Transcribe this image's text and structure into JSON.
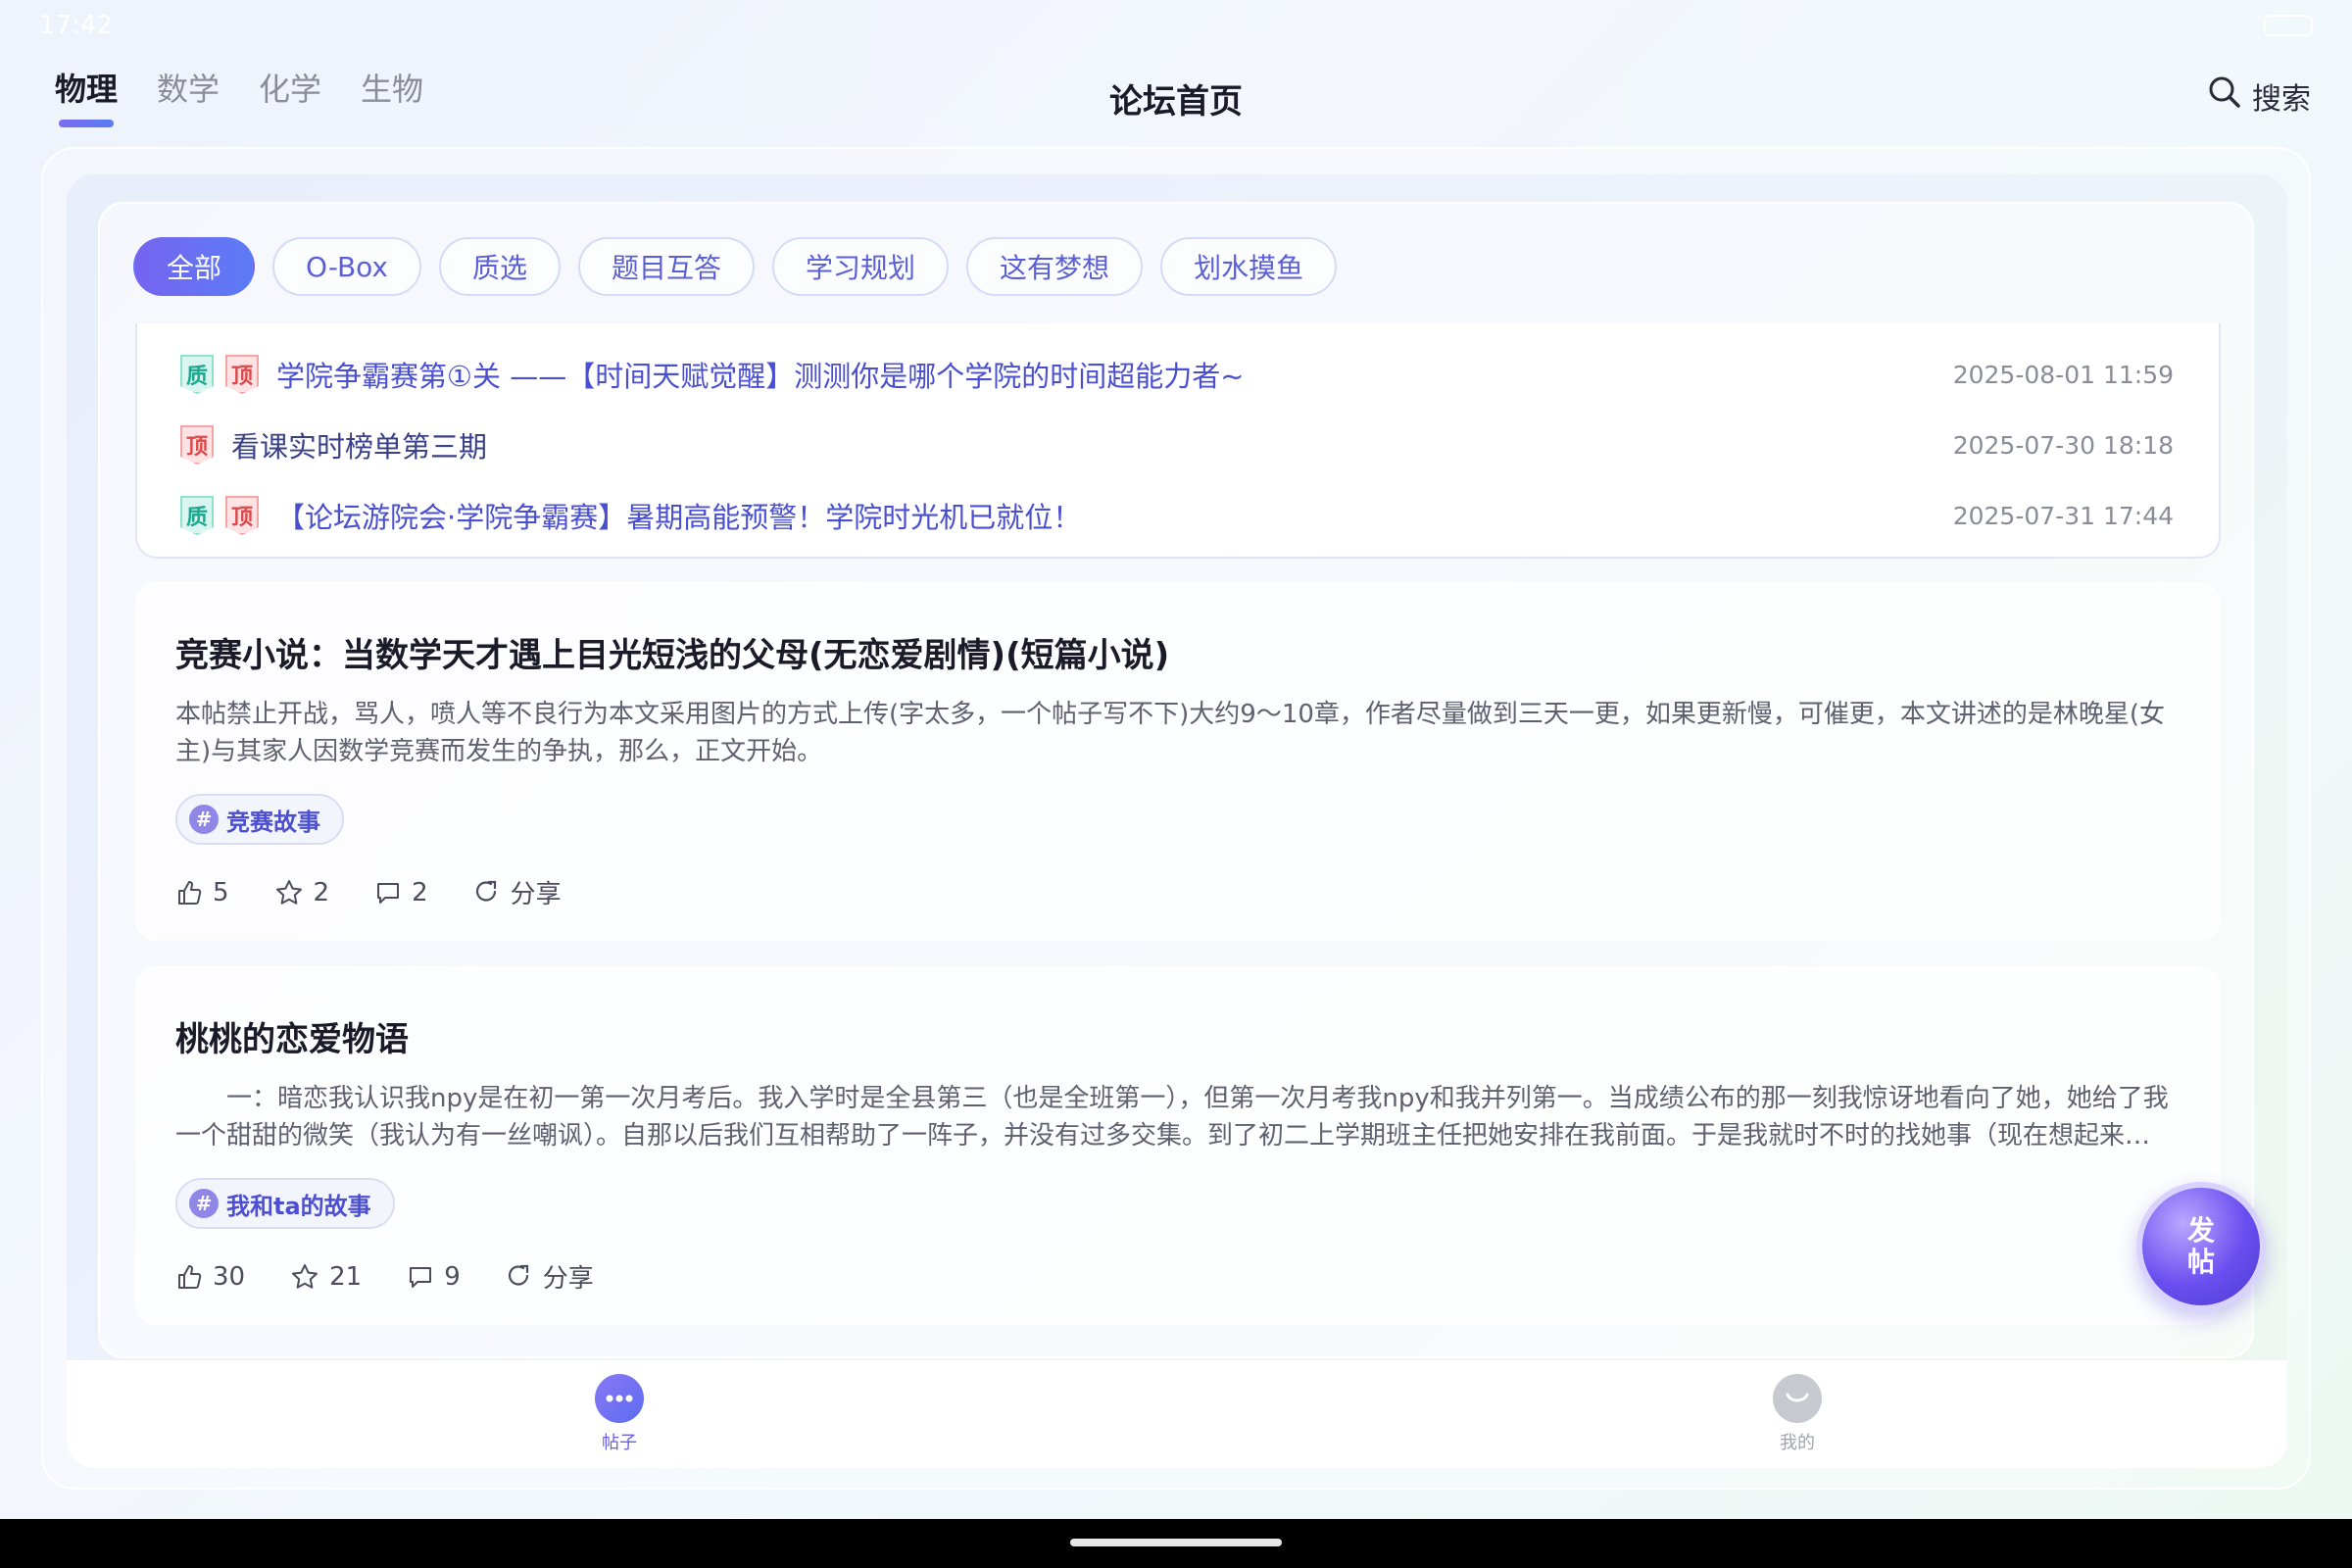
{
  "status_bar": {
    "time": "17:42"
  },
  "header": {
    "subject_tabs": [
      {
        "label": "物理"
      },
      {
        "label": "数学"
      },
      {
        "label": "化学"
      },
      {
        "label": "生物"
      }
    ],
    "active_subject": "物理",
    "title": "论坛首页",
    "search_label": "搜索"
  },
  "categories": [
    {
      "label": "全部"
    },
    {
      "label": "O-Box"
    },
    {
      "label": "质选"
    },
    {
      "label": "题目互答"
    },
    {
      "label": "学习规划"
    },
    {
      "label": "这有梦想"
    },
    {
      "label": "划水摸鱼"
    }
  ],
  "active_category": "全部",
  "pinned_posts": [
    {
      "badges": [
        "质",
        "顶"
      ],
      "title": "学院争霸赛第①关 ——【时间天赋觉醒】测测你是哪个学院的时间超能力者~",
      "date": "2025-08-01 11:59"
    },
    {
      "badges": [
        "顶"
      ],
      "title": "看课实时榜单第三期",
      "date": "2025-07-30 18:18"
    },
    {
      "badges": [
        "质",
        "顶"
      ],
      "title": "【论坛游院会·学院争霸赛】暑期高能预警！学院时光机已就位！",
      "date": "2025-07-31 17:44"
    }
  ],
  "posts": [
    {
      "title": "竞赛小说：当数学天才遇上目光短浅的父母(无恋爱剧情)(短篇小说)",
      "excerpt": "本帖禁止开战，骂人，喷人等不良行为本文采用图片的方式上传(字太多，一个帖子写不下)大约9～10章，作者尽量做到三天一更，如果更新慢，可催更，本文讲述的是林晚星(女主)与其家人因数学竞赛而发生的争执，那么，正文开始。",
      "tag": "竞赛故事",
      "likes": "5",
      "favorites": "2",
      "comments": "2",
      "share_label": "分享"
    },
    {
      "title": "桃桃的恋爱物语",
      "excerpt": "　　一：暗恋我认识我npy是在初一第一次月考后。我入学时是全县第三（也是全班第一），但第一次月考我npy和我并列第一。当成绩公布的那一刻我惊讶地看向了她，她给了我一个甜甜的微笑（我认为有一丝嘲讽）。自那以后我们互相帮助了一阵子，并没有过多交集。到了初二上学期班主任把她安排在我前面。于是我就时不时的找她事（现在想起来…",
      "tag": "我和ta的故事",
      "likes": "30",
      "favorites": "21",
      "comments": "9",
      "share_label": "分享"
    }
  ],
  "fab_label_line1": "发",
  "fab_label_line2": "帖",
  "bottom_nav": [
    {
      "label": "帖子",
      "icon": "chat-bubble-icon"
    },
    {
      "label": "我的",
      "icon": "profile-icon"
    }
  ],
  "colors": {
    "accent": "#6a5ee6",
    "pin_title": "#4a4fd0",
    "badge_quality": "#1ba88d",
    "badge_top": "#e04848"
  }
}
